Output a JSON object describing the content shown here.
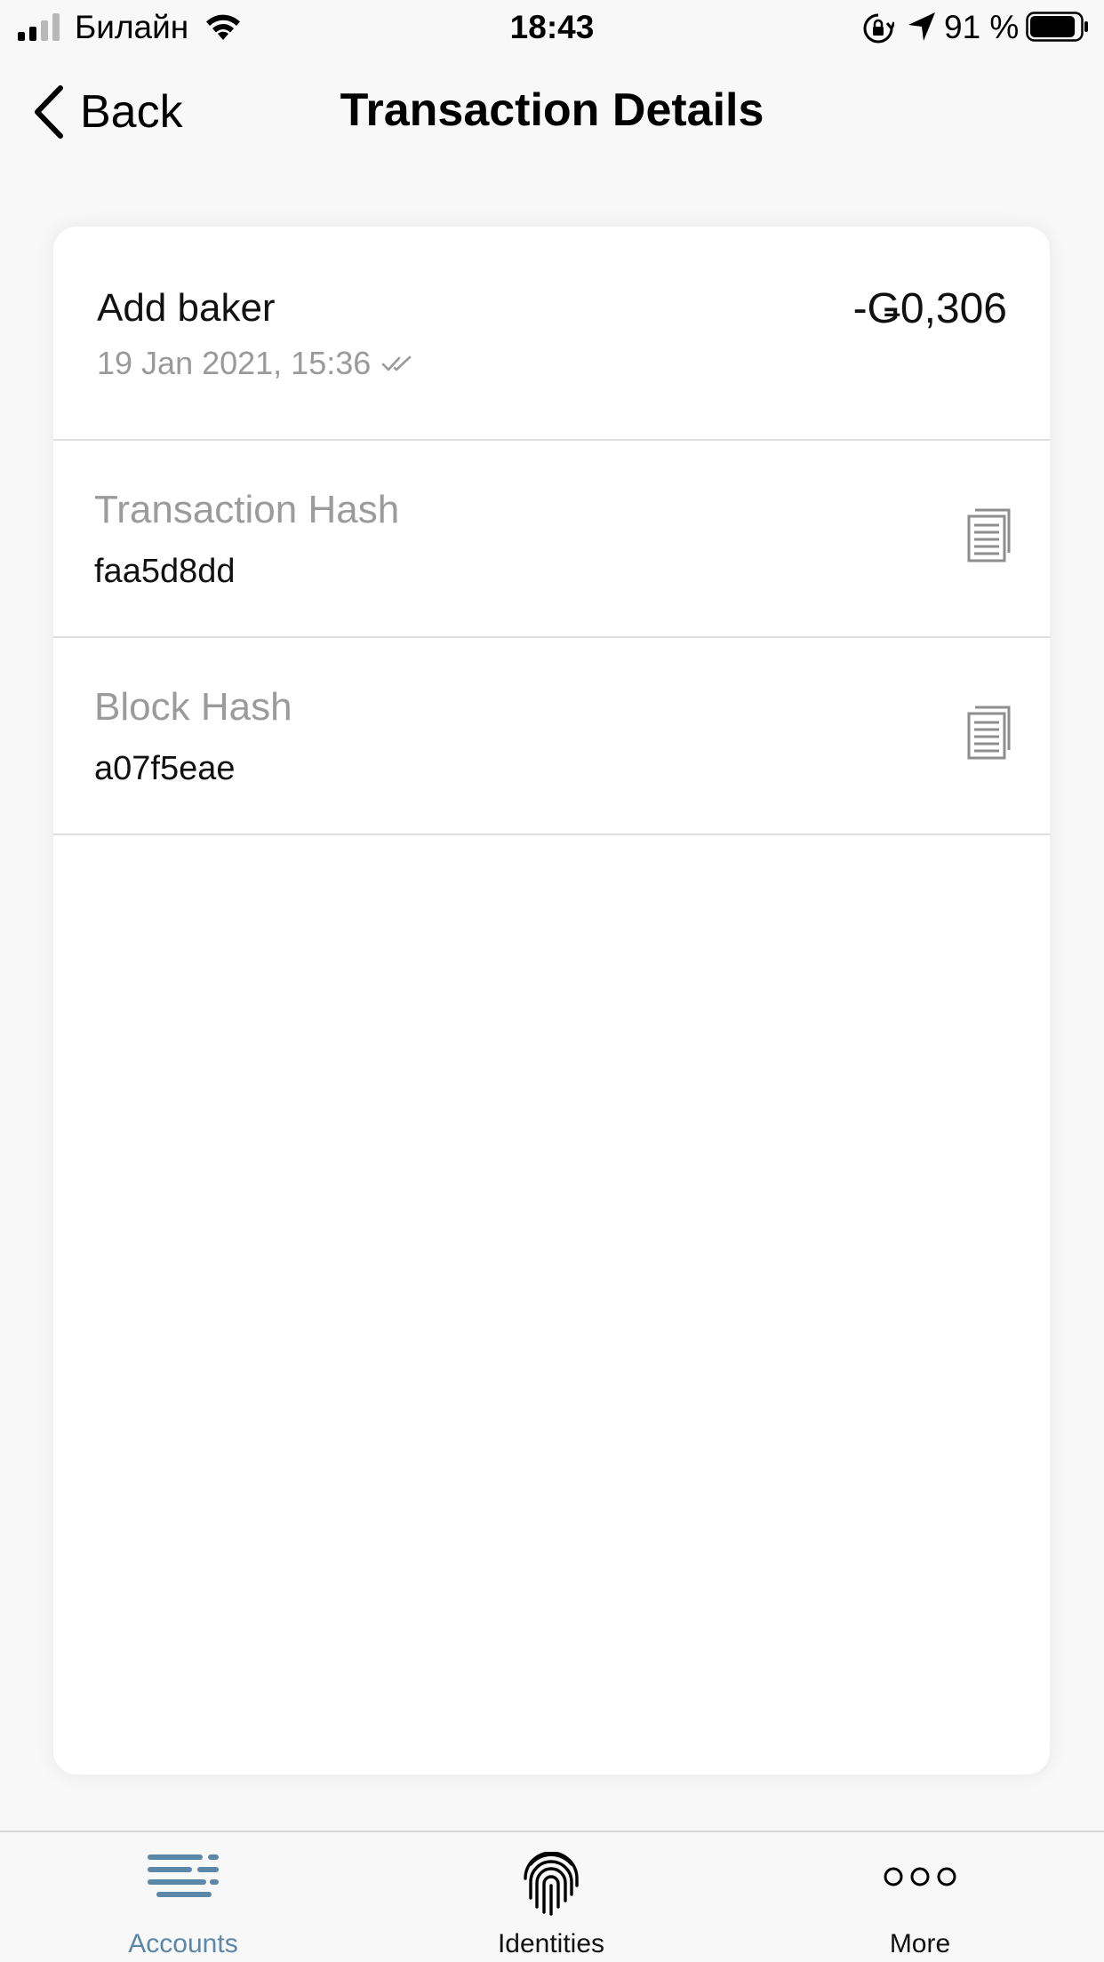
{
  "status_bar": {
    "carrier": "Билайн",
    "time": "18:43",
    "battery_percent": "91 %",
    "battery_level": 0.91,
    "signal_bars": 2,
    "icons": [
      "signal-icon",
      "wifi-icon",
      "orientation-lock-icon",
      "location-icon",
      "battery-icon"
    ]
  },
  "nav": {
    "back_label": "Back",
    "title": "Transaction Details",
    "icons": [
      "chevron-left-icon"
    ]
  },
  "transaction": {
    "title": "Add baker",
    "amount": "-Ǥ0,306",
    "date": "19 Jan 2021, 15:36",
    "status_icon": "double-check-icon"
  },
  "details": [
    {
      "label": "Transaction Hash",
      "value": "faa5d8dd",
      "icon": "copy-icon"
    },
    {
      "label": "Block Hash",
      "value": "a07f5eae",
      "icon": "copy-icon"
    }
  ],
  "tab_bar": {
    "tabs": [
      {
        "label": "Accounts",
        "icon": "accounts-list-icon",
        "active": true
      },
      {
        "label": "Identities",
        "icon": "fingerprint-icon",
        "active": false
      },
      {
        "label": "More",
        "icon": "more-dots-icon",
        "active": false
      }
    ]
  },
  "colors": {
    "accent": "#5b87a8",
    "secondary_text": "#9b9b9b",
    "divider": "#dedede",
    "background": "#f8f8f8",
    "card": "#ffffff"
  }
}
